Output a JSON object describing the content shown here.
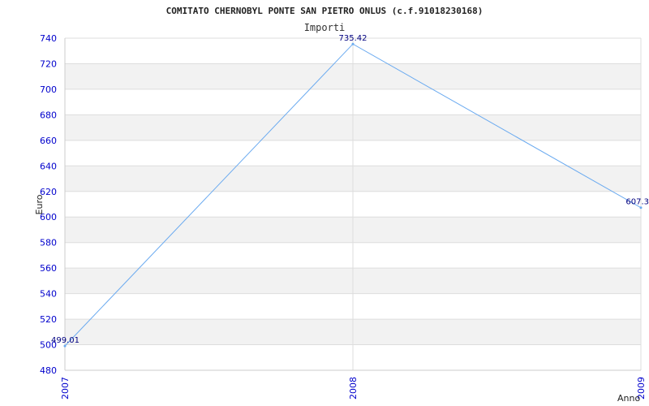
{
  "chart_data": {
    "type": "line",
    "title": "COMITATO CHERNOBYL PONTE SAN PIETRO ONLUS (c.f.91018230168)",
    "subtitle": "Importi",
    "xlabel": "Anno",
    "ylabel": "Euro",
    "categories": [
      "2007",
      "2008",
      "2009"
    ],
    "values": [
      499.01,
      735.42,
      607.3
    ],
    "value_labels": [
      "499.01",
      "735.42",
      "607.3"
    ],
    "ylim": [
      480,
      740
    ],
    "yticks": [
      480,
      500,
      520,
      540,
      560,
      580,
      600,
      620,
      640,
      660,
      680,
      700,
      720,
      740
    ],
    "line_color": "#6aaaf0",
    "band_color": "#f2f2f2",
    "tick_color": "#0000cc",
    "grid": true
  }
}
